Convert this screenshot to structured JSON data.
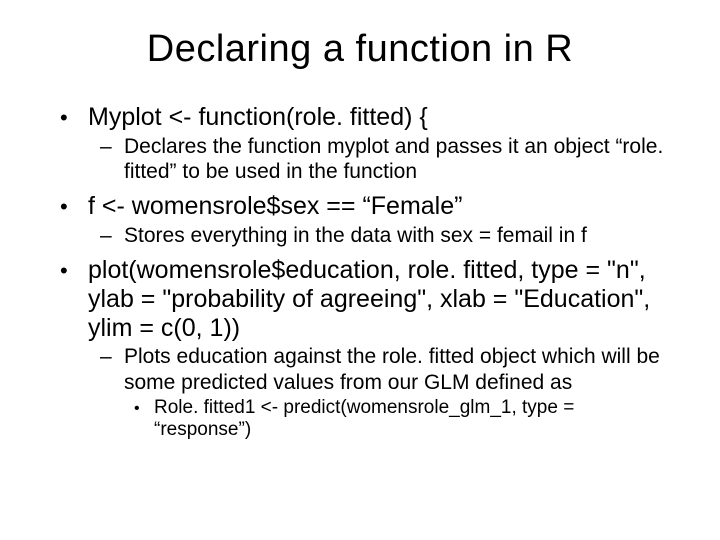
{
  "title": "Declaring a function in R",
  "items": [
    {
      "level": 1,
      "text": "Myplot <- function(role. fitted) {"
    },
    {
      "level": 2,
      "text": "Declares the function myplot and passes it an object “role. fitted” to be used in the function"
    },
    {
      "level": 1,
      "text": "f <- womensrole$sex == “Female”"
    },
    {
      "level": 2,
      "text": "Stores everything in the data with sex = femail in f"
    },
    {
      "level": 1,
      "text": "plot(womensrole$education, role. fitted, type = \"n\", ylab = \"probability of agreeing\", xlab = \"Education\", ylim = c(0, 1))"
    },
    {
      "level": 2,
      "text": "Plots education against the role. fitted object which will be some predicted values from our GLM defined as"
    },
    {
      "level": 3,
      "text": "Role. fitted1 <- predict(womensrole_glm_1, type = “response”)"
    }
  ],
  "markers": {
    "l1": "•",
    "l2": "–",
    "l3": "•"
  }
}
